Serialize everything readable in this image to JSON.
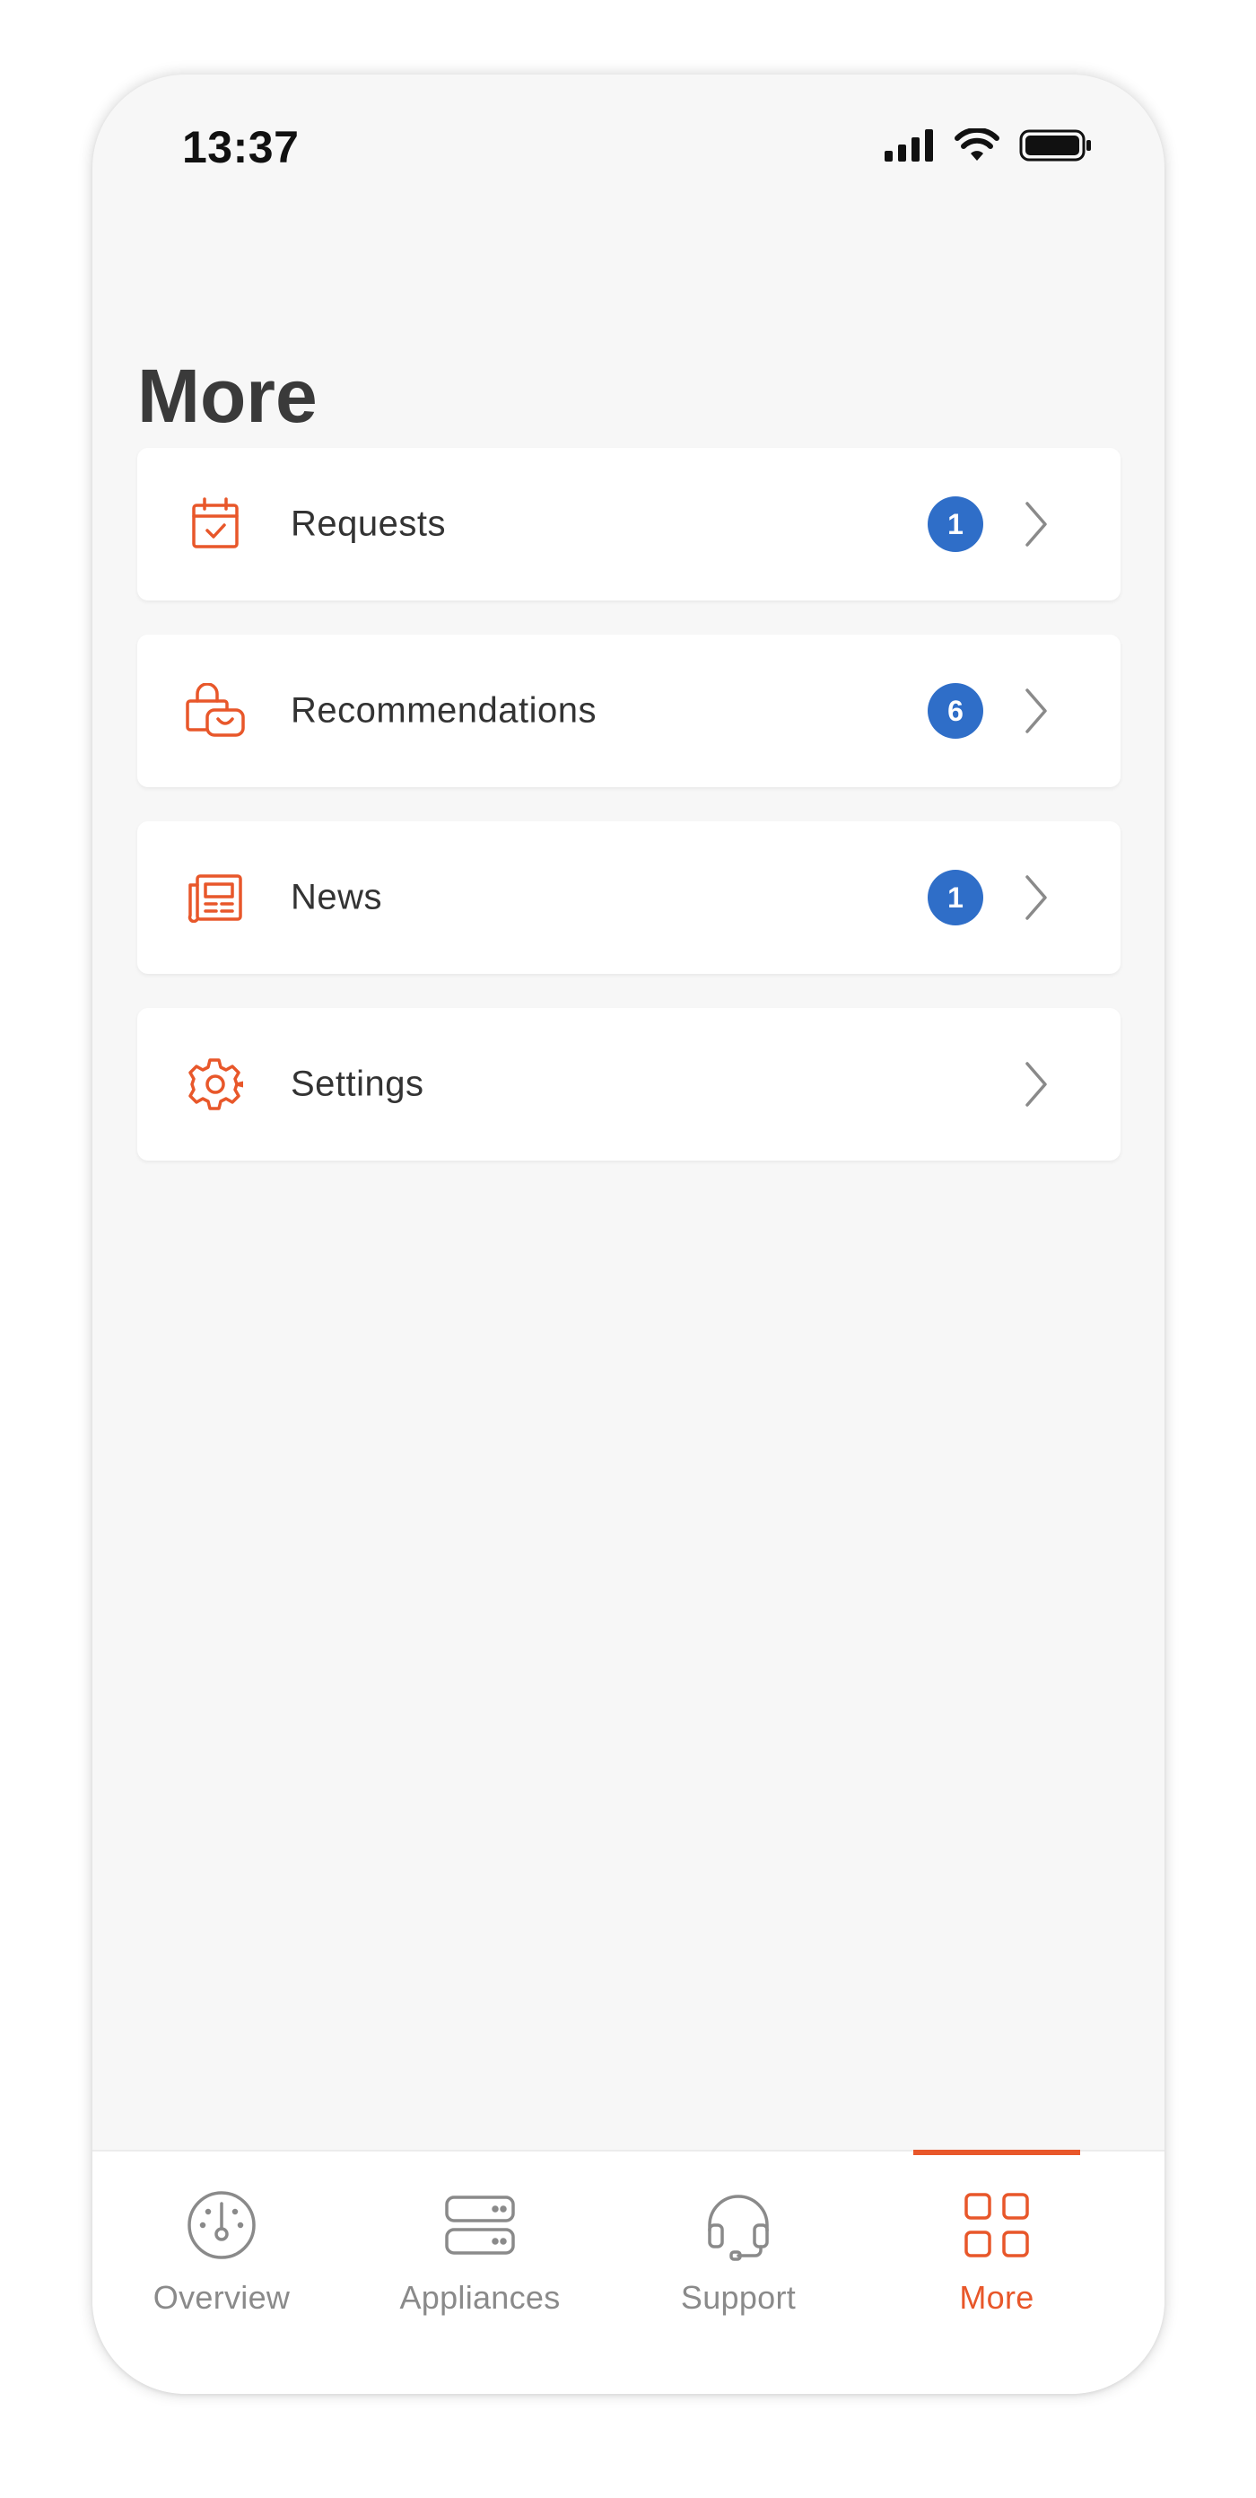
{
  "status_bar": {
    "time": "13:37",
    "icons": [
      "signal-icon",
      "wifi-icon",
      "battery-icon"
    ]
  },
  "page": {
    "title": "More"
  },
  "menu": {
    "items": [
      {
        "label": "Requests",
        "icon": "calendar-check-icon",
        "badge": "1"
      },
      {
        "label": "Recommendations",
        "icon": "shopping-bag-icon",
        "badge": "6"
      },
      {
        "label": "News",
        "icon": "newspaper-icon",
        "badge": "1"
      },
      {
        "label": "Settings",
        "icon": "gear-icon",
        "badge": null
      }
    ]
  },
  "tabs": {
    "items": [
      {
        "label": "Overview",
        "icon": "gauge-icon",
        "active": false
      },
      {
        "label": "Appliances",
        "icon": "server-icon",
        "active": false
      },
      {
        "label": "Support",
        "icon": "headset-icon",
        "active": false
      },
      {
        "label": "More",
        "icon": "grid-icon",
        "active": true
      }
    ]
  },
  "colors": {
    "accent": "#e8572a",
    "badge": "#2f6ec8",
    "background": "#f7f7f7",
    "card": "#ffffff",
    "inactive_tab": "#8a8a8a"
  }
}
